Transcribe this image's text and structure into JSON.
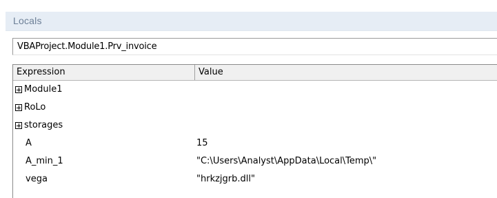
{
  "window": {
    "title": "Locals"
  },
  "context": {
    "procedure": "VBAProject.Module1.Prv_invoice"
  },
  "grid": {
    "columns": [
      "Expression",
      "Value"
    ],
    "rows": [
      {
        "expression": "Module1",
        "value": "",
        "expandable": true,
        "icon": "expand-plus-icon"
      },
      {
        "expression": "RoLo",
        "value": "",
        "expandable": true,
        "icon": "expand-plus-icon"
      },
      {
        "expression": "storages",
        "value": "",
        "expandable": true,
        "icon": "expand-plus-icon"
      },
      {
        "expression": "A",
        "value": "15",
        "expandable": false
      },
      {
        "expression": "A_min_1",
        "value": "\"C:\\Users\\Analyst\\AppData\\Local\\Temp\\\"",
        "expandable": false
      },
      {
        "expression": "vega",
        "value": "\"hrkzjgrb.dll\"",
        "expandable": false
      }
    ]
  }
}
